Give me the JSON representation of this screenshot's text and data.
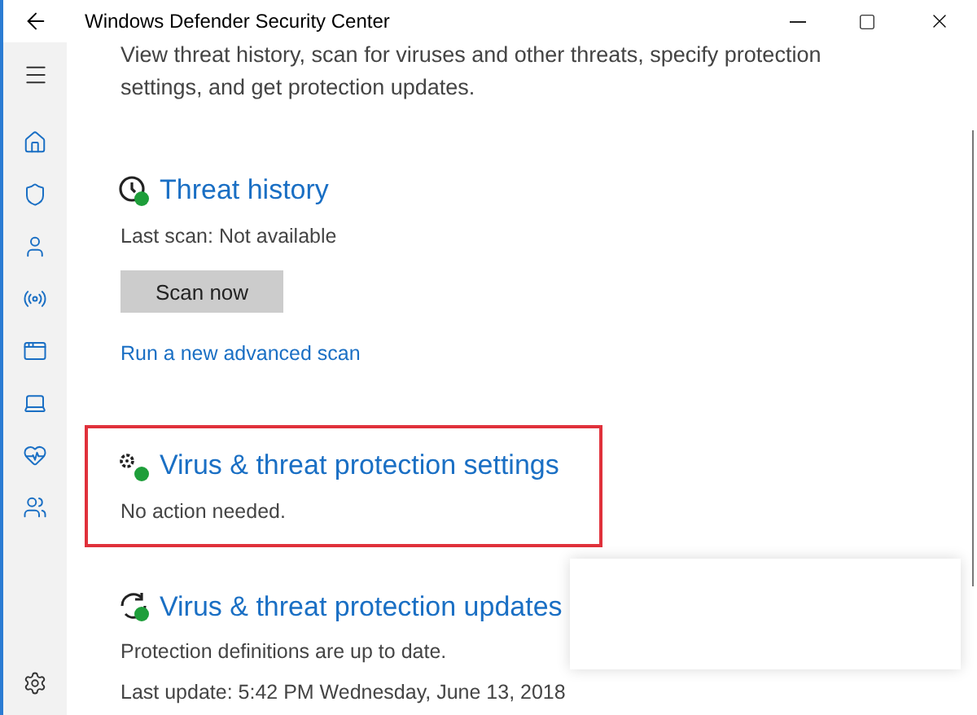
{
  "window": {
    "title": "Windows Defender Security Center"
  },
  "intro": "View threat history, scan for viruses and other threats, specify protection settings, and get protection updates.",
  "sections": [
    {
      "kind": "history",
      "title": "Threat history",
      "highlighted": false,
      "lines": [
        "Last scan:  Not available"
      ],
      "button": "Scan now",
      "link": "Run a new advanced scan"
    },
    {
      "kind": "settings",
      "title": "Virus & threat protection settings",
      "highlighted": true,
      "lines": [
        "No action needed."
      ]
    },
    {
      "kind": "updates",
      "title": "Virus & threat protection updates",
      "highlighted": false,
      "lines": [
        "Protection definitions are up to date.",
        "Last update: 5:42 PM Wednesday, June 13, 2018"
      ]
    }
  ]
}
